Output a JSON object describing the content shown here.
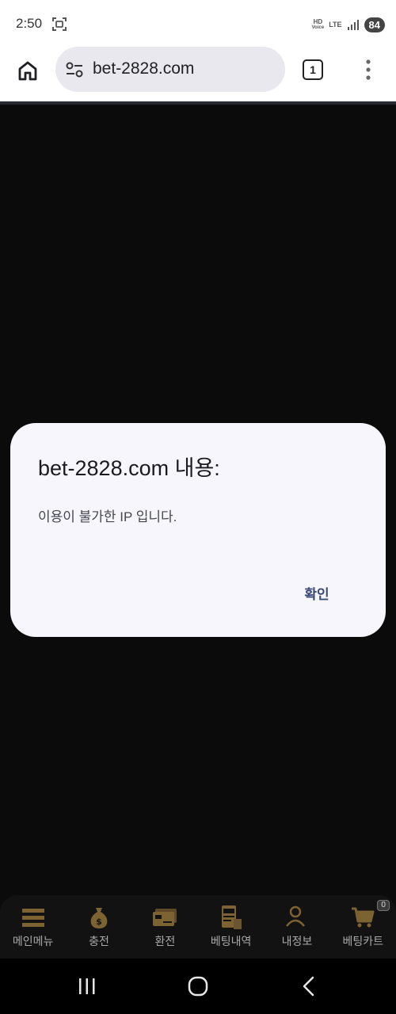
{
  "status_bar": {
    "time": "2:50",
    "hd_label_top": "HD",
    "hd_label_bottom": "Voice",
    "network": "LTE",
    "battery": "84",
    "icons": [
      "screen-capture-icon",
      "hd-voice-icon",
      "lte-icon",
      "signal-icon",
      "battery-icon"
    ]
  },
  "browser": {
    "url": "bet-2828.com",
    "tab_count": "1",
    "icons": [
      "home-icon",
      "site-settings-icon",
      "tabs-icon",
      "overflow-menu-icon"
    ]
  },
  "dialog": {
    "title": "bet-2828.com 내용:",
    "message": "이용이 불가한 IP 입니다.",
    "ok_label": "확인"
  },
  "bottom_nav": {
    "items": [
      {
        "label": "메인메뉴",
        "icon": "menu-icon"
      },
      {
        "label": "충전",
        "icon": "money-bag-icon"
      },
      {
        "label": "환전",
        "icon": "card-icon"
      },
      {
        "label": "베팅내역",
        "icon": "bet-history-icon"
      },
      {
        "label": "내정보",
        "icon": "my-info-icon"
      },
      {
        "label": "베팅카트",
        "icon": "cart-icon"
      }
    ],
    "cart_count": "0",
    "accent_color": "#7d6232",
    "bg_color": "#121212"
  },
  "system_nav": {
    "icons": [
      "recent-apps-icon",
      "home-circle-icon",
      "back-icon"
    ]
  },
  "colors": {
    "page_background": "#0b0b0b",
    "dialog_background": "#f7f6fd",
    "dialog_button": "#3a4a78"
  }
}
